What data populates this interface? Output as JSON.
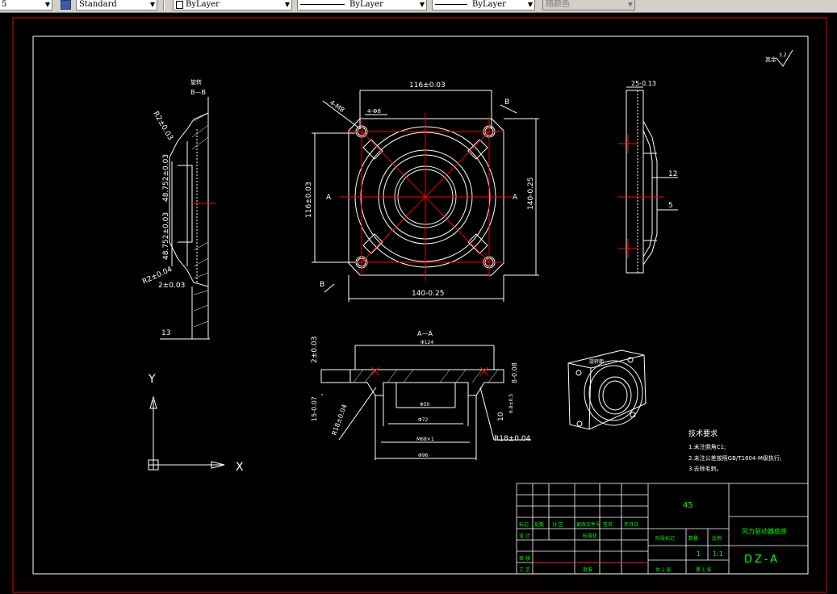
{
  "toolbar": {
    "first_value": "5",
    "text_style": "Standard",
    "layer": "ByLayer",
    "linetype": "ByLayer",
    "lineweight": "ByLayer",
    "plot_style": "随颜色"
  },
  "drawing": {
    "surface_mark": "其余",
    "surface_value": "3.2",
    "section_title_bb_1": "旋转",
    "section_title_bb_2": "B—B",
    "dim_top_width": "116±0.03",
    "dim_holes": "4-M8",
    "dim_holes2": "4-Φ8",
    "label_b_top": "B",
    "label_b_bottom": "B",
    "label_a_left": "A",
    "label_a_right": "A",
    "dim_left_height": "116±0.03",
    "dim_right_height": "140-0.25",
    "dim_bottom_width": "140-0.25",
    "dim_side_top": "25-0.13",
    "dim_side_12": "12",
    "dim_side_5": "5",
    "dim_r2_top": "R2±0.03",
    "dim_48752_top": "48.752±0.03",
    "dim_48752_bottom": "48.752±0.03",
    "dim_r2_bottom": "R2±0.04",
    "dim_2_bottom": "2±0.03",
    "dim_13": "13",
    "section_aa": "A—A",
    "dim_aa_phi": "Φ124",
    "dim_aa_left": "2±0.03",
    "dim_aa_right_top": "8-0.08",
    "dim_aa_15": "15-0.07",
    "dim_aa_r18_left": "R18±0.04",
    "dim_aa_phi50": "Φ50",
    "dim_aa_phi72": "Φ72",
    "dim_aa_m68": "M68×1",
    "dim_aa_phi96": "Φ96",
    "dim_aa_10": "10",
    "dim_aa_r18_right": "R18±0.04",
    "dim_aa_side": "6.8±0.5",
    "iso_label": "旋转面",
    "axis_y": "Y",
    "axis_x": "X"
  },
  "tech_req": {
    "title": "技术要求",
    "line1": "1.未注倒角C1;",
    "line2": "2.未注公差按照GB/T1804-M级执行;",
    "line3": "3.去除毛刺。"
  },
  "title_block": {
    "material": "45",
    "part_name": "风力驱动器底座",
    "drawing_no": "DZ-A",
    "qty_label": "数量",
    "scale_label": "比例",
    "stage_label": "阶段标记",
    "qty_value": "1",
    "scale_value": "1:1",
    "sheets_total": "共 1 张",
    "sheet_no": "第 1 张",
    "h_mark": "标记",
    "h_count": "处数",
    "h_zone": "分 区",
    "h_doc": "更改文件号",
    "h_sign": "签名",
    "h_date": "年月日",
    "r_design": "设 计",
    "r_std": "标准化",
    "r_check": "审 核",
    "r_process": "工 艺",
    "r_approve": "批准"
  },
  "colors": {
    "background": "#000000",
    "line": "#ffffff",
    "center": "#ff0000",
    "border_red": "#c00000",
    "green": "#00ff00"
  }
}
